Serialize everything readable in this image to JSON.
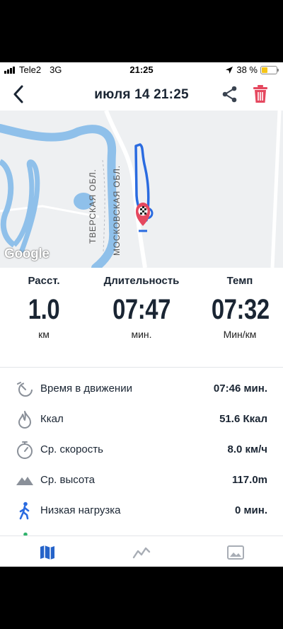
{
  "status_bar": {
    "carrier": "Tele2",
    "network": "3G",
    "time": "21:25",
    "battery_percent": "38 %",
    "battery_level": 0.38
  },
  "header": {
    "title": "июля 14  21:25"
  },
  "map": {
    "attribution": "Google",
    "labels": [
      "ТВЕРСКАЯ ОБЛ.",
      "МОСКОВСКАЯ ОБЛ."
    ]
  },
  "stats": [
    {
      "label": "Расст.",
      "value": "1.0",
      "unit": "км"
    },
    {
      "label": "Длительность",
      "value": "07:47",
      "unit": "мин."
    },
    {
      "label": "Темп",
      "value": "07:32",
      "unit": "Мин/км"
    }
  ],
  "details": [
    {
      "icon": "stopwatch-moving-icon",
      "label": "Время в движении",
      "value": "07:46 мин."
    },
    {
      "icon": "flame-icon",
      "label": "Ккал",
      "value": "51.6 Ккал"
    },
    {
      "icon": "speedometer-icon",
      "label": "Ср. скорость",
      "value": "8.0 км/ч"
    },
    {
      "icon": "mountain-icon",
      "label": "Ср. высота",
      "value": "117.0m"
    },
    {
      "icon": "walking-person-icon",
      "label": "Низкая нагрузка",
      "value": "0 мин."
    }
  ],
  "tabs": [
    {
      "icon": "map-icon",
      "active": true
    },
    {
      "icon": "chart-icon",
      "active": false
    },
    {
      "icon": "photo-icon",
      "active": false
    }
  ],
  "colors": {
    "accent": "#2563c9",
    "delete": "#e5485f",
    "text": "#1a2533",
    "route": "#2a6be0",
    "water": "#8fc0ea"
  }
}
